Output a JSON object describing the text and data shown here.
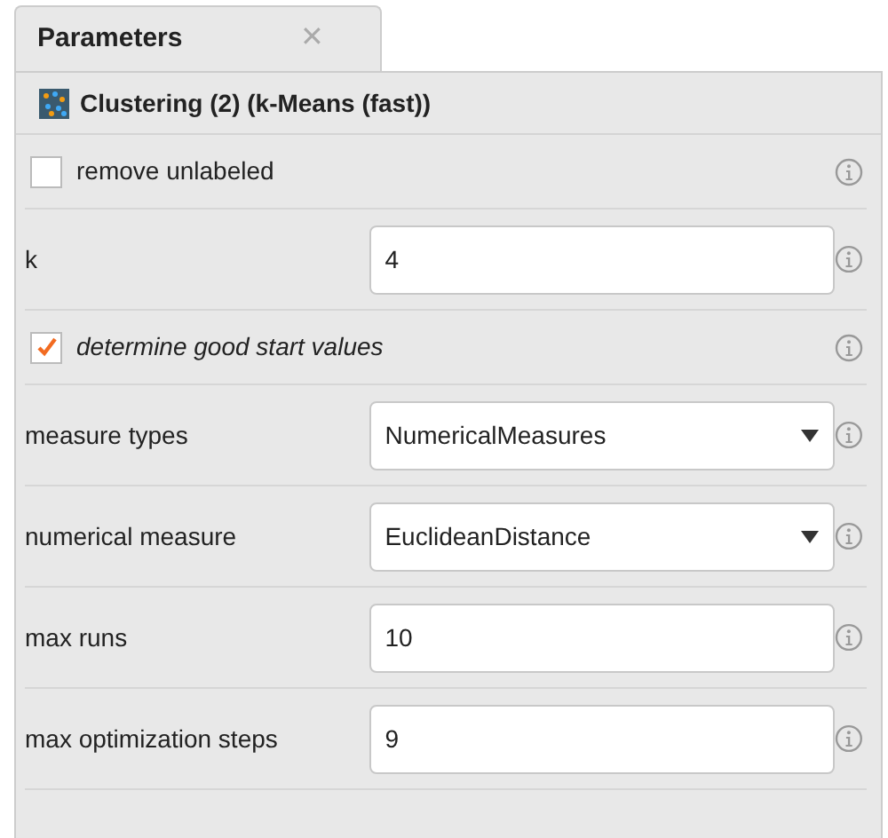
{
  "tab": {
    "label": "Parameters",
    "close": "✕",
    "selected": true
  },
  "operator": {
    "title": "Clustering (2) (k-Means (fast))"
  },
  "parameters": [
    {
      "kind": "checkbox",
      "label": "remove unlabeled",
      "checked": false,
      "expert": false
    },
    {
      "kind": "text",
      "label": "k",
      "value": "4"
    },
    {
      "kind": "checkbox",
      "label": "determine good start values",
      "checked": true,
      "expert": true
    },
    {
      "kind": "select",
      "label": "measure types",
      "value": "NumericalMeasures"
    },
    {
      "kind": "select",
      "label": "numerical measure",
      "value": "EuclideanDistance"
    },
    {
      "kind": "text",
      "label": "max runs",
      "value": "10"
    },
    {
      "kind": "text",
      "label": "max optimization steps",
      "value": "9"
    }
  ]
}
